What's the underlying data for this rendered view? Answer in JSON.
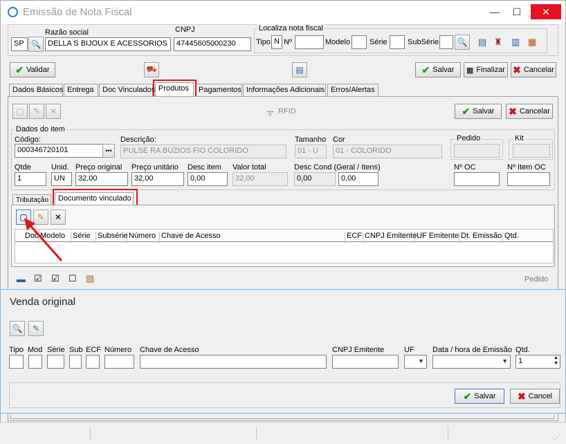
{
  "window": {
    "title": "Emissão de Nota Fiscal",
    "min_glyph": "—",
    "max_glyph": "☐",
    "close_glyph": "✕"
  },
  "header": {
    "uf_value": "SP",
    "razao_label": "Razão social",
    "razao_value": "DELLA S BIJOUX E ACESSORIOS LTD",
    "cnpj_label": "CNPJ",
    "cnpj_value": "47445605000230",
    "localiza_label": "Localiza nota fiscal",
    "tipo_label": "Tipo",
    "tipo_value": "N",
    "numero_label": "Nº",
    "modelo_label": "Modelo",
    "serie_label": "Série",
    "subserie_label": "SubSérie"
  },
  "toolbar": {
    "validar": "Validar",
    "salvar": "Salvar",
    "finalizar": "Finalizar",
    "cancelar": "Cancelar"
  },
  "tabs": [
    "Dados Básicos",
    "Entrega",
    "Doc Vinculados",
    "Produtos",
    "Pagamentos",
    "Informações Adicionais",
    "Erros/Alertas"
  ],
  "produtos": {
    "rfid": "RFID",
    "salvar": "Salvar",
    "cancelar": "Cancelar",
    "group_label": "Dados do item",
    "codigo_label": "Código:",
    "codigo_value": "000346720101",
    "descricao_label": "Descrição:",
    "descricao_value": "PULSE RA BUZIOS FIO COLORIDO",
    "tamanho_label": "Tamanho",
    "tamanho_value": "01 - U",
    "cor_label": "Cor",
    "cor_value": "01 - COLORIDO",
    "pedido_label": "Pedido",
    "kit_label": "Kit",
    "qtde_label": "Qtde",
    "qtde_value": "1",
    "unid_label": "Unid.",
    "unid_value": "UN",
    "preco_orig_label": "Preço original",
    "preco_orig_value": "32,00",
    "preco_unit_label": "Preço unitário",
    "preco_unit_value": "32,00",
    "desc_item_label": "Desc item",
    "desc_item_value": "0,00",
    "valor_total_label": "Valor total",
    "valor_total_value": "32,00",
    "desc_cond_label": "Desc Cond (Geral / Itens)",
    "desc_cond_geral": "0,00",
    "desc_cond_itens": "0,00",
    "num_oc_label": "Nº OC",
    "num_item_oc_label": "Nº Item OC"
  },
  "subtabs": [
    "Tributação",
    "Documento vinculado"
  ],
  "grid_headers": [
    "Doc",
    "Modelo",
    "Série",
    "Subsérie",
    "Número",
    "Chave de Acesso",
    "ECF",
    "CNPJ Emitente",
    "UF Emitente",
    "Dt. Emissão",
    "Qtd."
  ],
  "lower_pedido": "Pedido",
  "dialog": {
    "title": "Venda original",
    "cols": [
      "Tipo",
      "Mod",
      "Série",
      "Sub",
      "ECF",
      "Número",
      "Chave de Acesso",
      "CNPJ Emitente",
      "UF",
      "Data / hora de Emissão",
      "Qtd."
    ],
    "qtd_value": "1",
    "salvar": "Salvar",
    "cancel": "Cancel"
  }
}
